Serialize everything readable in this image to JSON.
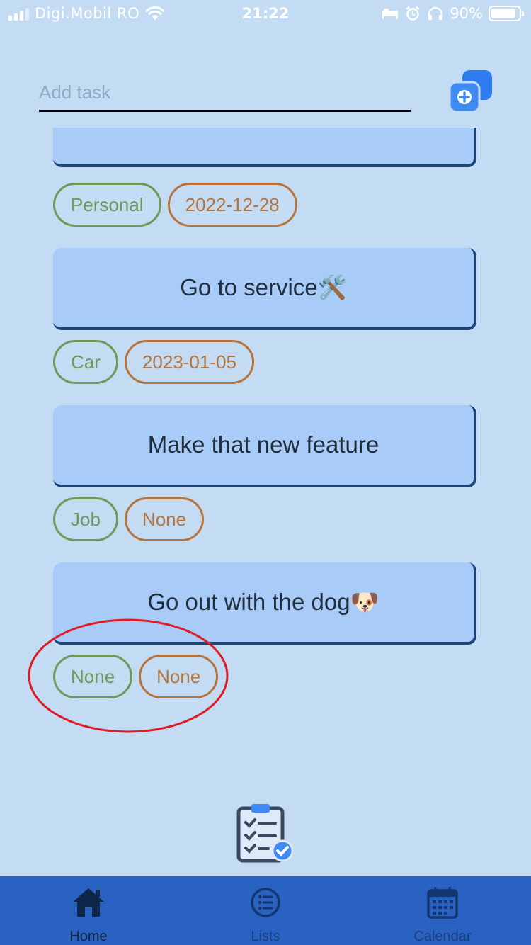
{
  "status_bar": {
    "carrier": "Digi.Mobil RO",
    "time": "21:22",
    "battery": "90%"
  },
  "add_task": {
    "placeholder": "Add task",
    "value": "",
    "button_icon": "add-task-icon"
  },
  "tasks": [
    {
      "title": "",
      "category": "Personal",
      "date": "2022-12-28"
    },
    {
      "title": "Go to service🛠️",
      "category": "Car",
      "date": "2023-01-05"
    },
    {
      "title": "Make that new feature",
      "category": "Job",
      "date": "None"
    },
    {
      "title": "Go out with the dog🐶",
      "category": "None",
      "date": "None"
    }
  ],
  "app_logo": "checklist-icon",
  "nav": {
    "items": [
      {
        "label": "Home",
        "icon": "home-icon",
        "active": true
      },
      {
        "label": "Lists",
        "icon": "list-icon",
        "active": false
      },
      {
        "label": "Calendar",
        "icon": "calendar-icon",
        "active": false
      }
    ]
  },
  "colors": {
    "background": "#c3dcf4",
    "card": "#a9cbf8",
    "card_shadow": "#1c4477",
    "category_tag": "#6d9a57",
    "date_tag": "#b7733a",
    "nav_bar": "#2a62c1",
    "annotation": "#e01b24"
  }
}
